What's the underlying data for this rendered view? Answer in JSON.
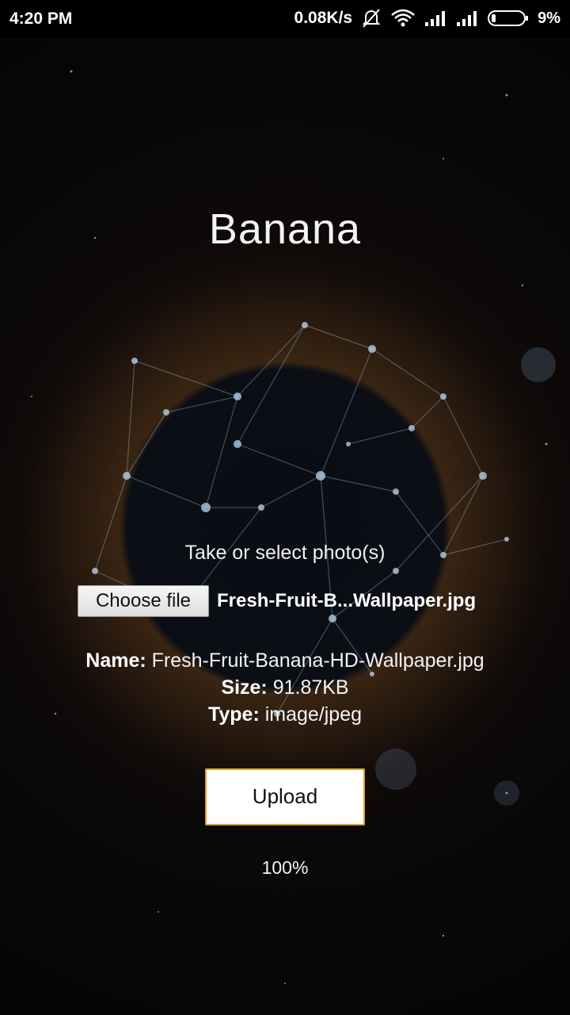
{
  "status_bar": {
    "time": "4:20 PM",
    "network_speed": "0.08K/s",
    "battery_percent": "9%",
    "icons": [
      "mute-icon",
      "wifi-icon",
      "signal-icon",
      "signal-icon",
      "battery-icon"
    ]
  },
  "page": {
    "title": "Banana",
    "prompt": "Take or select photo(s)",
    "choose_file_label": "Choose file",
    "selected_file_display": "Fresh-Fruit-B...Wallpaper.jpg"
  },
  "file_info": {
    "name_label": "Name:",
    "name_value": "Fresh-Fruit-Banana-HD-Wallpaper.jpg",
    "size_label": "Size:",
    "size_value": "91.87KB",
    "type_label": "Type:",
    "type_value": "image/jpeg"
  },
  "upload": {
    "button_label": "Upload",
    "progress_text": "100%",
    "progress_fraction": 1.0
  },
  "colors": {
    "status_bar_bg": "#000000",
    "upload_border": "#d9a32c",
    "text": "#f4f4f4"
  }
}
